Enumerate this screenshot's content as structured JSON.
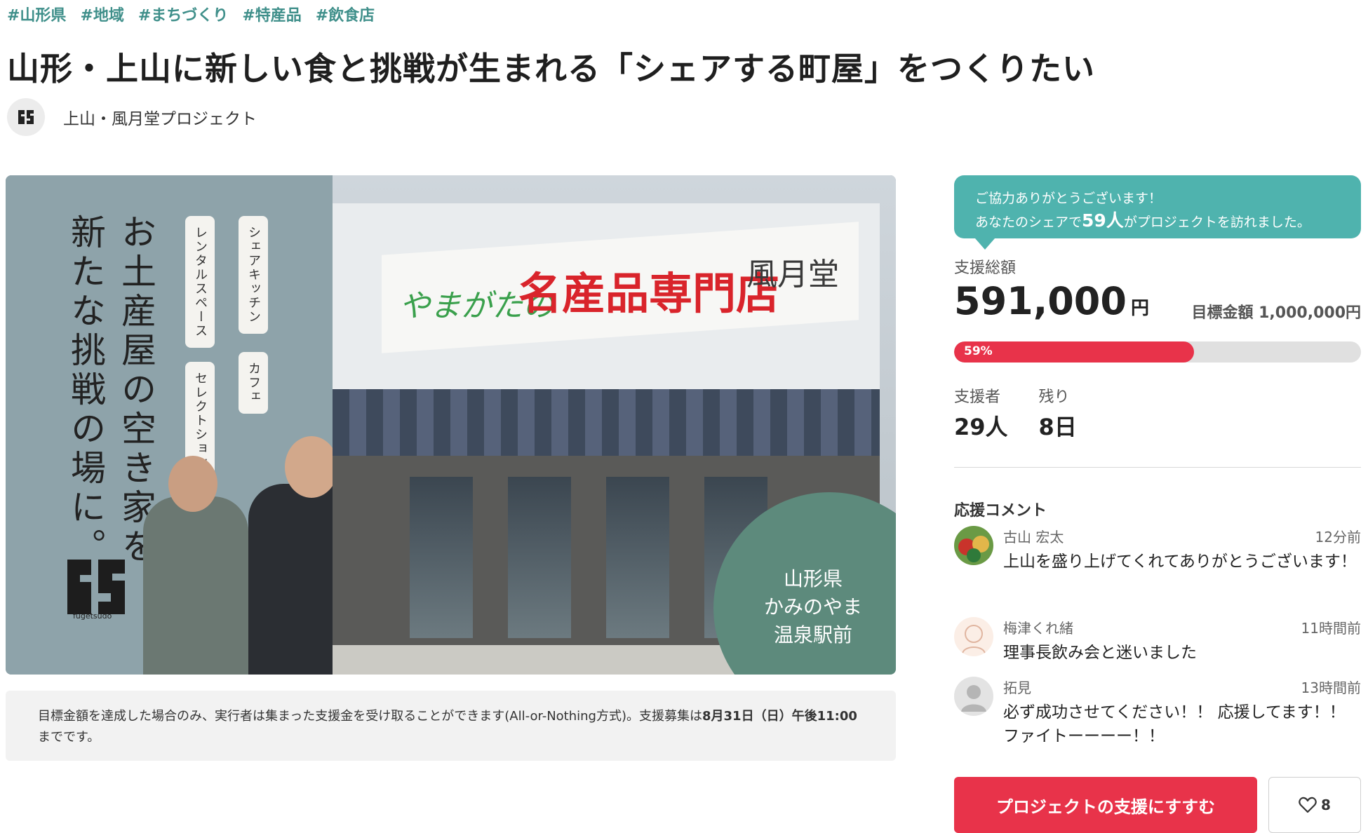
{
  "tags": [
    "#山形県",
    "#地域",
    "#まちづくり",
    "#特産品",
    "#飲食店"
  ],
  "title": "山形・上山に新しい食と挑戦が生まれる「シェアする町屋」をつくりたい",
  "owner": {
    "name": "上山・風月堂プロジェクト",
    "avatar_icon": "fugetsudo-logo-icon"
  },
  "hero": {
    "main_vertical_1": "お土産屋の空き家を",
    "main_vertical_2": "新たな挑戦の場に。",
    "pills": [
      "シェアキッチン",
      "レンタルスペース",
      "カフェ",
      "セレクトショップ"
    ],
    "logo_text": "fugetsudo",
    "sign_green": "やまがたの",
    "sign_red": "名産品専門店",
    "sign_store": "風月堂",
    "badge_line1": "山形県",
    "badge_line2": "かみのやま",
    "badge_line3": "温泉駅前"
  },
  "notice": {
    "text_before": "目標金額を達成した場合のみ、実行者は集まった支援金を受け取ることができます(All-or-Nothing方式)。支援募集は",
    "deadline": "8月31日（日）午後11:00",
    "text_after": "までです。"
  },
  "share": {
    "line1": "ご協力ありがとうございます！",
    "line2_before": "あなたのシェアで",
    "count": "59人",
    "line2_after": "がプロジェクトを訪れました。"
  },
  "funding": {
    "total_label": "支援総額",
    "amount": "591,000",
    "unit": "円",
    "goal_label": "目標金額 1,000,000円",
    "progress_label": "59%",
    "progress_fraction": 0.59,
    "supporters_label": "支援者",
    "supporters_value": "29人",
    "remaining_label": "残り",
    "remaining_value": "8日"
  },
  "comments": {
    "heading": "応援コメント",
    "items": [
      {
        "name": "古山 宏太",
        "time": "12分前",
        "text": "上山を盛り上げてくれてありがとうございます！"
      },
      {
        "name": "梅津くれ緒",
        "time": "11時間前",
        "text": "理事長飲み会と迷いました"
      },
      {
        "name": "拓見",
        "time": "13時間前",
        "text": "必ず成功させてください！！ 応援してます！！ファイトーーーー！！"
      }
    ]
  },
  "actions": {
    "support_label": "プロジェクトの支援にすすむ",
    "favorite_count": "8",
    "favorite_icon": "heart-icon"
  },
  "colors": {
    "accent_teal": "#4fb3ae",
    "accent_red": "#e8334a",
    "tag_teal": "#3f8f8a"
  }
}
